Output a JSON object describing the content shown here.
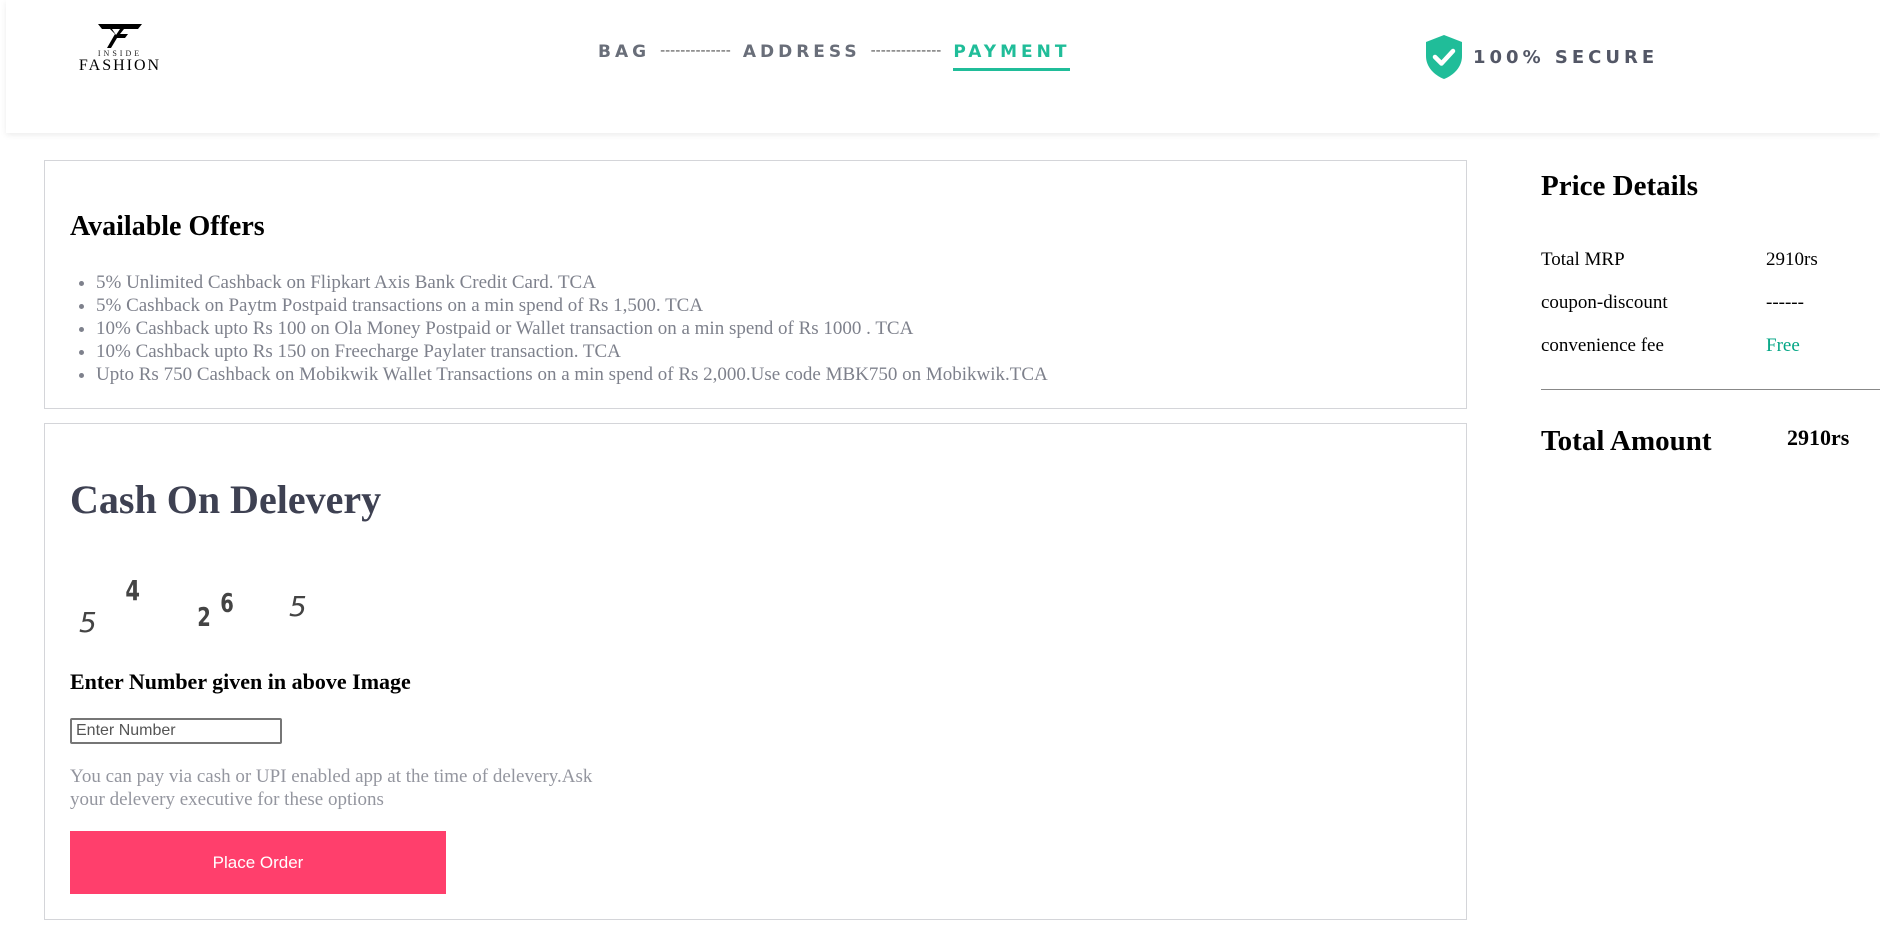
{
  "brand": {
    "logo_small": "INSIDE",
    "logo_big": "FASHION"
  },
  "steps": [
    {
      "label": "BAG",
      "active": false
    },
    {
      "label": "ADDRESS",
      "active": false
    },
    {
      "label": "PAYMENT",
      "active": true
    }
  ],
  "step_separator": "--------------",
  "secure": {
    "label": "100% SECURE",
    "icon": "shield-check-icon",
    "color": "#20bd99"
  },
  "offers": {
    "title": "Available Offers",
    "items": [
      "5% Unlimited Cashback on Flipkart Axis Bank Credit Card. TCA",
      "5% Cashback on Paytm Postpaid transactions on a min spend of Rs 1,500. TCA",
      "10% Cashback upto Rs 100 on Ola Money Postpaid or Wallet transaction on a min spend of Rs 1000 . TCA",
      "10% Cashback upto Rs 150 on Freecharge Paylater transaction. TCA",
      "Upto Rs 750 Cashback on Mobikwik Wallet Transactions on a min spend of Rs 2,000.Use code MBK750 on Mobikwik.TCA"
    ]
  },
  "cod": {
    "title": "Cash On Delevery",
    "captcha_digits": [
      "5",
      "4",
      "2",
      "6",
      "5"
    ],
    "prompt": "Enter Number given in above Image",
    "input_placeholder": "Enter Number",
    "input_value": "",
    "note": "You can pay via cash or UPI enabled app at the time of delevery.Ask your delevery executive for these options",
    "button_label": "Place Order",
    "button_color": "#ff3f6c"
  },
  "price_details": {
    "title": "Price Details",
    "rows": [
      {
        "label": "Total MRP",
        "value": "2910rs"
      },
      {
        "label": "coupon-discount",
        "value": "------"
      },
      {
        "label": "convenience fee",
        "value": "Free"
      }
    ],
    "total_label": "Total Amount",
    "total_value": "2910rs"
  }
}
